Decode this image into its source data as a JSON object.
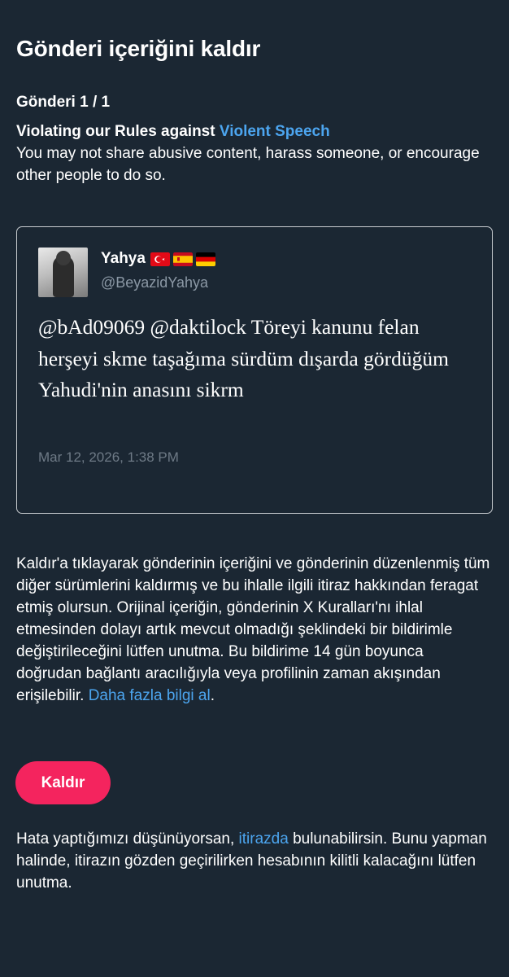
{
  "header": {
    "title": "Gönderi içeriğini kaldır"
  },
  "post_counter": "Gönderi 1 / 1",
  "violation": {
    "heading_prefix": "Violating our Rules against ",
    "rule_link": "Violent Speech",
    "description": "You may not share abusive content, harass someone, or encourage other people to do so."
  },
  "tweet": {
    "display_name": "Yahya",
    "flags": [
      "turkey-flag-icon",
      "spain-flag-icon",
      "germany-flag-icon"
    ],
    "handle": "@BeyazidYahya",
    "text": "@bAd09069 @daktilock Töreyi kanunu felan herşeyi skme taşağıma sürdüm dışarda gördüğüm Yahudi'nin anasını sikrm",
    "timestamp": "Mar 12, 2026, 1:38 PM"
  },
  "info": {
    "body": "Kaldır'a tıklayarak gönderinin içeriğini ve gönderinin düzenlenmiş tüm diğer sürümlerini kaldırmış ve bu ihlalle ilgili itiraz hakkından feragat etmiş olursun. Orijinal içeriğin, gönderinin X Kuralları'nı ihlal etmesinden dolayı artık mevcut olmadığı şeklindeki bir bildirimle değiştirileceğini lütfen unutma. Bu bildirime 14 gün boyunca doğrudan bağlantı aracılığıyla veya profilinin zaman akışından erişilebilir. ",
    "learn_more": "Daha fazla bilgi al",
    "period": "."
  },
  "remove_button": "Kaldır",
  "appeal": {
    "prefix": "Hata yaptığımızı düşünüyorsan, ",
    "link": "itirazda",
    "suffix": " bulunabilirsin. Bunu yapman halinde, itirazın gözden geçirilirken hesabının kilitli kalacağını lütfen unutma."
  },
  "colors": {
    "background": "#1b2733",
    "link": "#4ca5ef",
    "button": "#f4245e",
    "secondary_text": "#8b98a5"
  }
}
